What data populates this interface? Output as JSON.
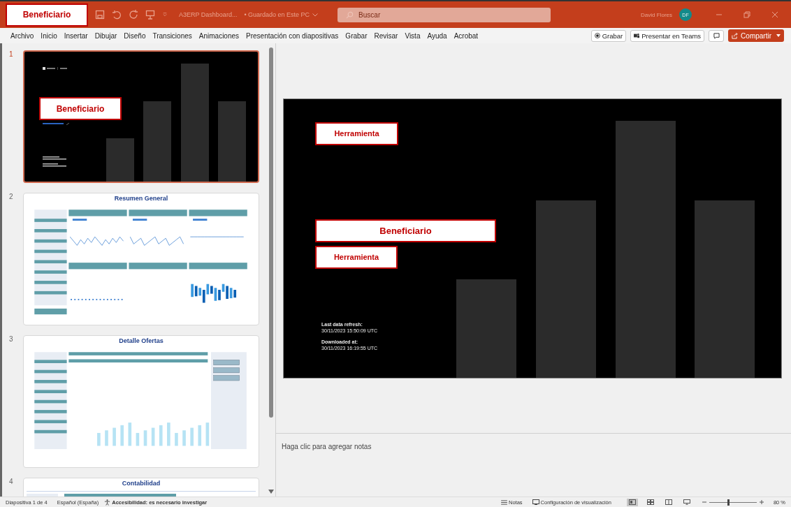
{
  "title_bar": {
    "annotation": "Beneficiario",
    "document": "A3ERP Dashboard...",
    "save_status": "• Guardado en Este PC",
    "search": {
      "placeholder": "Buscar"
    },
    "user": "David Flores",
    "avatar": "DF"
  },
  "menu": [
    "Archivo",
    "Inicio",
    "Insertar",
    "Dibujar",
    "Diseño",
    "Transiciones",
    "Animaciones",
    "Presentación con diapositivas",
    "Grabar",
    "Revisar",
    "Vista",
    "Ayuda",
    "Acrobat"
  ],
  "ribbon_buttons": [
    {
      "kind": "record",
      "label": "Grabar"
    },
    {
      "kind": "teams",
      "label": "Presentar en Teams"
    }
  ],
  "share": "Compartir",
  "thumbnails": [
    {
      "number": "1",
      "selected": true,
      "kind": "cover",
      "annotation": "Beneficiario"
    },
    {
      "number": "2",
      "selected": false,
      "kind": "overview",
      "title": "Resumen General"
    },
    {
      "number": "3",
      "selected": false,
      "kind": "table",
      "title": "Detalle Ofertas"
    },
    {
      "number": "4",
      "selected": false,
      "kind": "ledger",
      "title": "Contabilidad"
    }
  ],
  "slide": {
    "annotations": [
      "Herramienta",
      "Beneficiario",
      "Herramienta"
    ],
    "refresh_label": "Last data refresh:",
    "refresh_time": "30/11/2023 15:50:09 UTC",
    "download_label": "Downloaded at:",
    "download_time": "30/11/2023 16:19:55 UTC"
  },
  "notes": {
    "placeholder": "Haga clic para agregar notas"
  },
  "status_bar": {
    "slide": "Diapositiva 1 de 4",
    "language": "Español (España)",
    "accessibility": "Accesibilidad: es necesario investigar",
    "notes": "Notas",
    "display": "Configuración de visualización",
    "views": [
      {
        "kind": "normal",
        "selected": true
      },
      {
        "kind": "sorter",
        "selected": false
      },
      {
        "kind": "reading",
        "selected": false
      },
      {
        "kind": "presenter",
        "selected": false
      }
    ],
    "zoom": {
      "level": 0.4,
      "reading": "80 %"
    }
  }
}
